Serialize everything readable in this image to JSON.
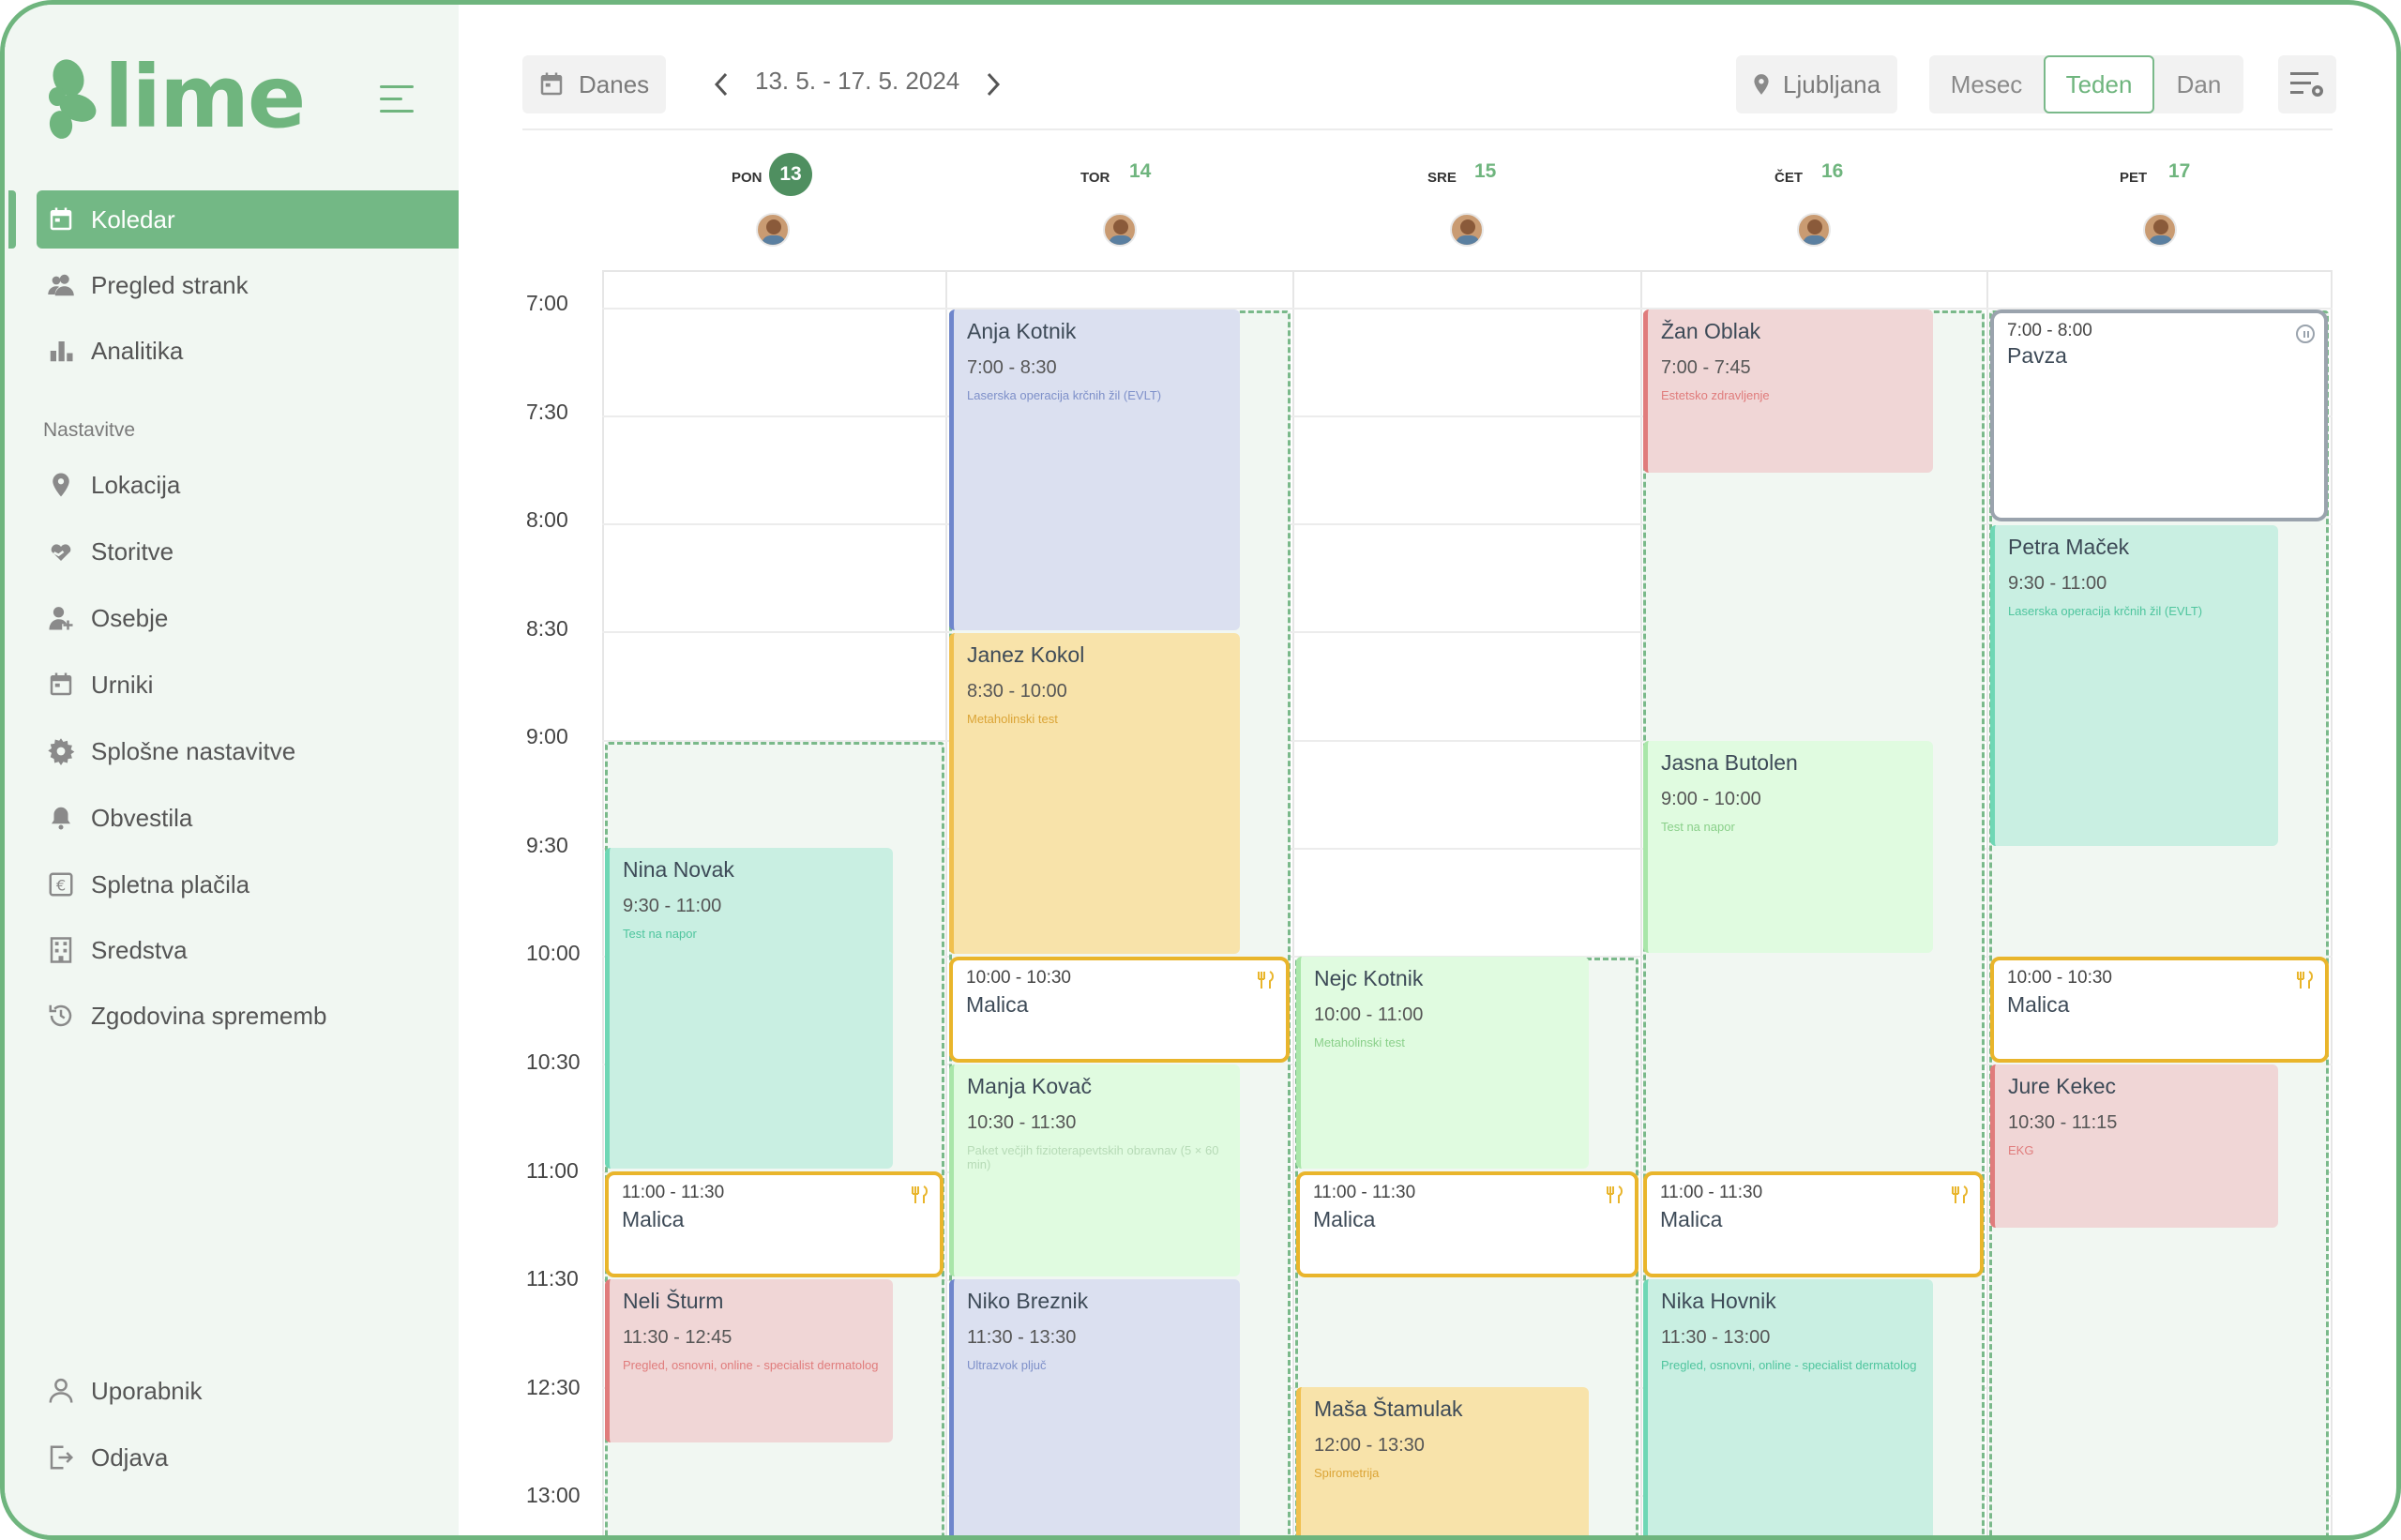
{
  "app": {
    "logo_text": "lime"
  },
  "sidebar": {
    "items": [
      {
        "label": "Koledar",
        "icon": "calendar-icon"
      },
      {
        "label": "Pregled strank",
        "icon": "users-icon"
      },
      {
        "label": "Analitika",
        "icon": "bar-chart-icon"
      }
    ],
    "section_label": "Nastavitve",
    "settings_items": [
      {
        "label": "Lokacija",
        "icon": "location-pin-icon"
      },
      {
        "label": "Storitve",
        "icon": "heart-hand-icon"
      },
      {
        "label": "Osebje",
        "icon": "add-user-icon"
      },
      {
        "label": "Urniki",
        "icon": "calendar-icon"
      },
      {
        "label": "Splošne nastavitve",
        "icon": "gear-icon"
      },
      {
        "label": "Obvestila",
        "icon": "bell-icon"
      },
      {
        "label": "Spletna plačila",
        "icon": "euro-icon"
      },
      {
        "label": "Sredstva",
        "icon": "building-icon"
      },
      {
        "label": "Zgodovina sprememb",
        "icon": "history-icon"
      }
    ],
    "bottom_items": [
      {
        "label": "Uporabnik",
        "icon": "user-icon"
      },
      {
        "label": "Odjava",
        "icon": "logout-icon"
      }
    ]
  },
  "toolbar": {
    "today_label": "Danes",
    "date_range": "13. 5. - 17. 5. 2024",
    "location": "Ljubljana",
    "views": [
      "Mesec",
      "Teden",
      "Dan"
    ],
    "selected_view": "Teden"
  },
  "days": [
    {
      "name": "PON",
      "date": "13",
      "today": true
    },
    {
      "name": "TOR",
      "date": "14"
    },
    {
      "name": "SRE",
      "date": "15"
    },
    {
      "name": "ČET",
      "date": "16"
    },
    {
      "name": "PET",
      "date": "17"
    }
  ],
  "time_labels": [
    "7:00",
    "7:30",
    "8:00",
    "8:30",
    "9:00",
    "9:30",
    "10:00",
    "10:30",
    "11:00",
    "11:30",
    "12:30",
    "13:00"
  ],
  "events": {
    "tue_anja": {
      "name": "Anja Kotnik",
      "time": "7:00 - 8:30",
      "service": "Laserska operacija krčnih žil (EVLT)"
    },
    "tue_janez": {
      "name": "Janez Kokol",
      "time": "8:30 - 10:00",
      "service": "Metaholinski test"
    },
    "tue_manja": {
      "name": "Manja Kovač",
      "time": "10:30 - 11:30",
      "service": "Paket večjih fizioterapevtskih obravnav (5 × 60 min)"
    },
    "tue_niko": {
      "name": "Niko Breznik",
      "time": "11:30 - 13:30",
      "service": "Ultrazvok pljuč"
    },
    "mon_nina": {
      "name": "Nina Novak",
      "time": "9:30 - 11:00",
      "service": "Test na napor"
    },
    "mon_neli": {
      "name": "Neli Šturm",
      "time": "11:30 - 12:45",
      "service": "Pregled, osnovni, online - specialist dermatolog"
    },
    "wed_nejc": {
      "name": "Nejc Kotnik",
      "time": "10:00 - 11:00",
      "service": "Metaholinski test"
    },
    "wed_masa": {
      "name": "Maša Štamulak",
      "time": "12:00 - 13:30",
      "service": "Spirometrija"
    },
    "thu_zan": {
      "name": "Žan Oblak",
      "time": "7:00 - 7:45",
      "service": "Estetsko zdravljenje"
    },
    "thu_jasna": {
      "name": "Jasna Butolen",
      "time": "9:00 - 10:00",
      "service": "Test na napor"
    },
    "thu_nika": {
      "name": "Nika Hovnik",
      "time": "11:30 - 13:00",
      "service": "Pregled, osnovni, online - specialist dermatolog"
    },
    "fri_petra": {
      "name": "Petra Maček",
      "time": "9:30 - 11:00",
      "service": "Laserska operacija krčnih žil (EVLT)"
    },
    "fri_jure": {
      "name": "Jure Kekec",
      "time": "10:30 - 11:15",
      "service": "EKG"
    }
  },
  "breaks": {
    "mon": {
      "time": "11:00 - 11:30",
      "label": "Malica"
    },
    "tue": {
      "time": "10:00 - 10:30",
      "label": "Malica"
    },
    "wed": {
      "time": "11:00 - 11:30",
      "label": "Malica"
    },
    "thu": {
      "time": "11:00 - 11:30",
      "label": "Malica"
    },
    "fri": {
      "time": "10:00 - 10:30",
      "label": "Malica"
    },
    "fri_pause": {
      "time": "7:00 - 8:00",
      "label": "Pavza"
    }
  }
}
